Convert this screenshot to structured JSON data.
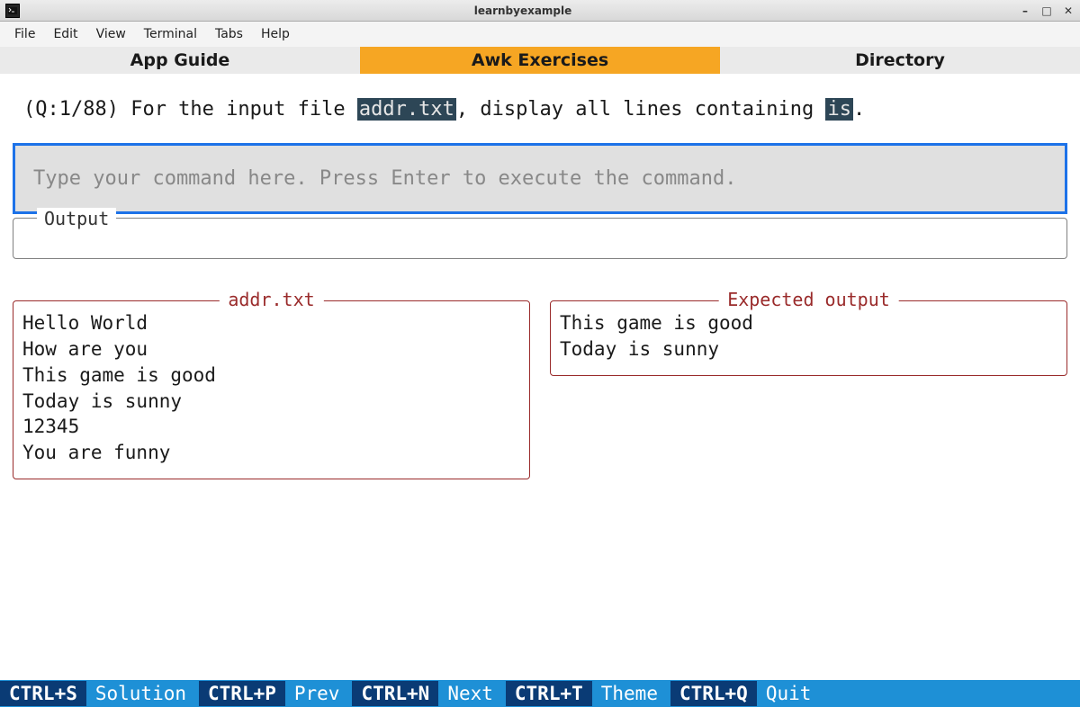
{
  "window": {
    "title": "learnbyexample"
  },
  "menubar": {
    "items": [
      "File",
      "Edit",
      "View",
      "Terminal",
      "Tabs",
      "Help"
    ]
  },
  "tabs": [
    {
      "label": "App Guide",
      "active": false
    },
    {
      "label": "Awk Exercises",
      "active": true
    },
    {
      "label": "Directory",
      "active": false
    }
  ],
  "question": {
    "prefix": "(Q:1/88) For the input file ",
    "code1": "addr.txt",
    "mid": ", display all lines containing ",
    "code2": "is",
    "suffix": "."
  },
  "command_input": {
    "placeholder": "Type your command here. Press Enter to execute the command."
  },
  "output": {
    "label": "Output",
    "content": ""
  },
  "input_file": {
    "title": "addr.txt",
    "content": "Hello World\nHow are you\nThis game is good\nToday is sunny\n12345\nYou are funny"
  },
  "expected": {
    "title": "Expected output",
    "content": "This game is good\nToday is sunny"
  },
  "footer": [
    {
      "key": "CTRL+S",
      "label": "Solution"
    },
    {
      "key": "CTRL+P",
      "label": "Prev"
    },
    {
      "key": "CTRL+N",
      "label": "Next"
    },
    {
      "key": "CTRL+T",
      "label": "Theme"
    },
    {
      "key": "CTRL+Q",
      "label": "Quit"
    }
  ]
}
